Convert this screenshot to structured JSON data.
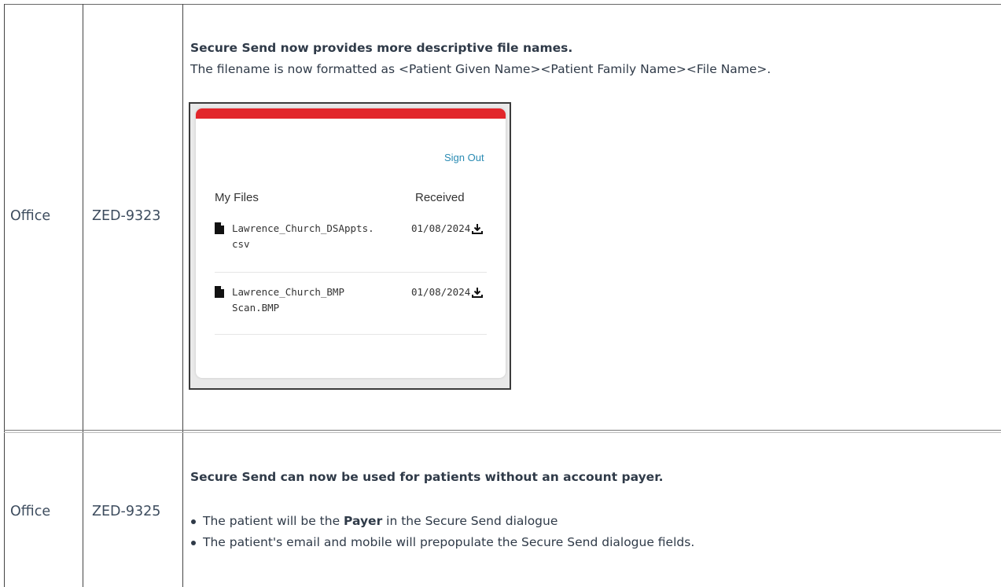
{
  "rows": [
    {
      "product": "Office",
      "ticket": "ZED-9323",
      "heading": "Secure Send now provides more descriptive file names.",
      "description": "The filename is now formatted as <Patient Given Name><Patient Family Name><File Name>.",
      "screenshot": {
        "sign_out": "Sign Out",
        "col_files": "My Files",
        "col_received": "Received",
        "files": [
          {
            "name": "Lawrence_Church_DSAppts. csv",
            "date": "01/08/2024"
          },
          {
            "name": "Lawrence_Church_BMP Scan.BMP",
            "date": "01/08/2024"
          }
        ]
      }
    },
    {
      "product": "Office",
      "ticket": "ZED-9325",
      "heading": "Secure Send can now be used for patients without an account payer.",
      "bullets": [
        {
          "pre": "The patient will be the ",
          "bold": "Payer",
          "post": " in the Secure Send dialogue"
        },
        {
          "pre": "The patient's email and mobile will prepopulate the Secure Send dialogue fields.",
          "bold": "",
          "post": ""
        }
      ]
    }
  ],
  "colors": {
    "accent_red": "#e2262b",
    "link_blue": "#2a8bb3"
  }
}
